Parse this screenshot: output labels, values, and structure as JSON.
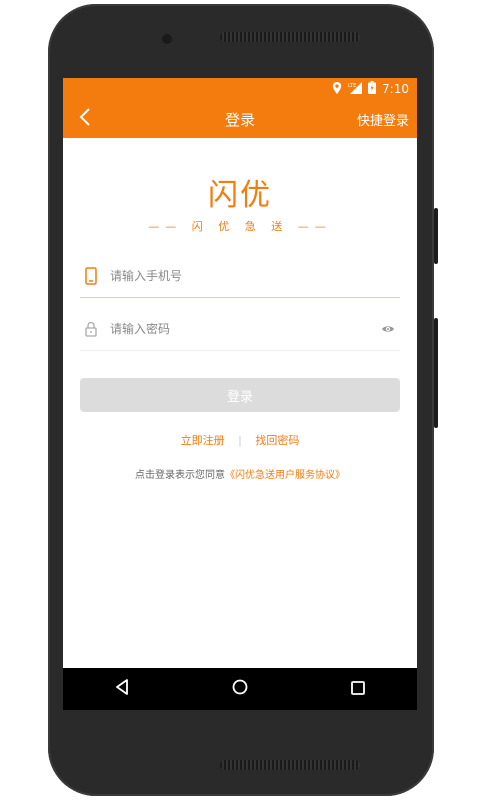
{
  "status_bar": {
    "time": "7:10",
    "icons": [
      "location-icon",
      "lte-signal-icon",
      "battery-icon"
    ]
  },
  "app_bar": {
    "back_icon": "chevron-left-icon",
    "title": "登录",
    "quick_login": "快捷登录"
  },
  "brand": {
    "logo_text": "闪优",
    "slogan": "闪 优 急 送"
  },
  "form": {
    "phone_placeholder": "请输入手机号",
    "phone_value": "",
    "password_placeholder": "请输入密码",
    "password_value": "",
    "login_button": "登录"
  },
  "links": {
    "register": "立即注册",
    "separator": "|",
    "forgot_password": "找回密码"
  },
  "agreement": {
    "prefix": "点击登录表示您同意",
    "link": "《闪优急送用户服务协议》"
  },
  "colors": {
    "accent": "#f47c0e",
    "button_disabled": "#dcdcdc"
  }
}
